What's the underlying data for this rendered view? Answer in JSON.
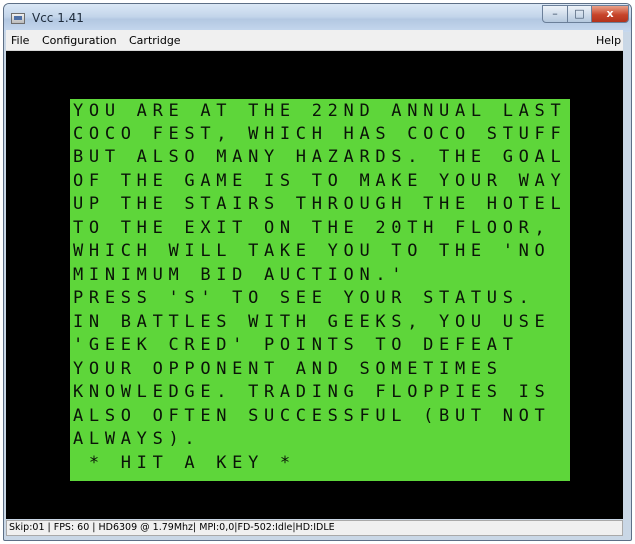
{
  "window": {
    "title": "Vcc 1.41"
  },
  "window_controls": {
    "minimize": "–",
    "maximize": "□",
    "close": "x"
  },
  "menu": {
    "file": "File",
    "configuration": "Configuration",
    "cartridge": "Cartridge",
    "help": "Help"
  },
  "screen": {
    "lines": [
      "YOU ARE AT THE 22ND ANNUAL LAST",
      "COCO FEST, WHICH HAS COCO STUFF",
      "BUT ALSO MANY HAZARDS. THE GOAL",
      "OF THE GAME IS TO MAKE YOUR WAY",
      "UP THE STAIRS THROUGH THE HOTEL",
      "TO THE EXIT ON THE 20TH FLOOR,",
      "WHICH WILL TAKE YOU TO THE 'NO",
      "MINIMUM BID AUCTION.'",
      "PRESS 'S' TO SEE YOUR STATUS.",
      "IN BATTLES WITH GEEKS, YOU USE",
      "'GEEK CRED' POINTS TO DEFEAT",
      "YOUR OPPONENT AND SOMETIMES",
      "KNOWLEDGE. TRADING FLOPPIES IS",
      "ALSO OFTEN SUCCESSFUL (BUT NOT",
      "ALWAYS).",
      " * HIT A KEY *"
    ]
  },
  "status_bar": {
    "text": "Skip:01 | FPS: 60 | HD6309 @ 1.79Mhz| MPI:0,0|FD-502:Idle|HD:IDLE"
  },
  "colors": {
    "screen_green": "#5ed63a",
    "border_black": "#000000",
    "text_dark": "#0a1408"
  }
}
